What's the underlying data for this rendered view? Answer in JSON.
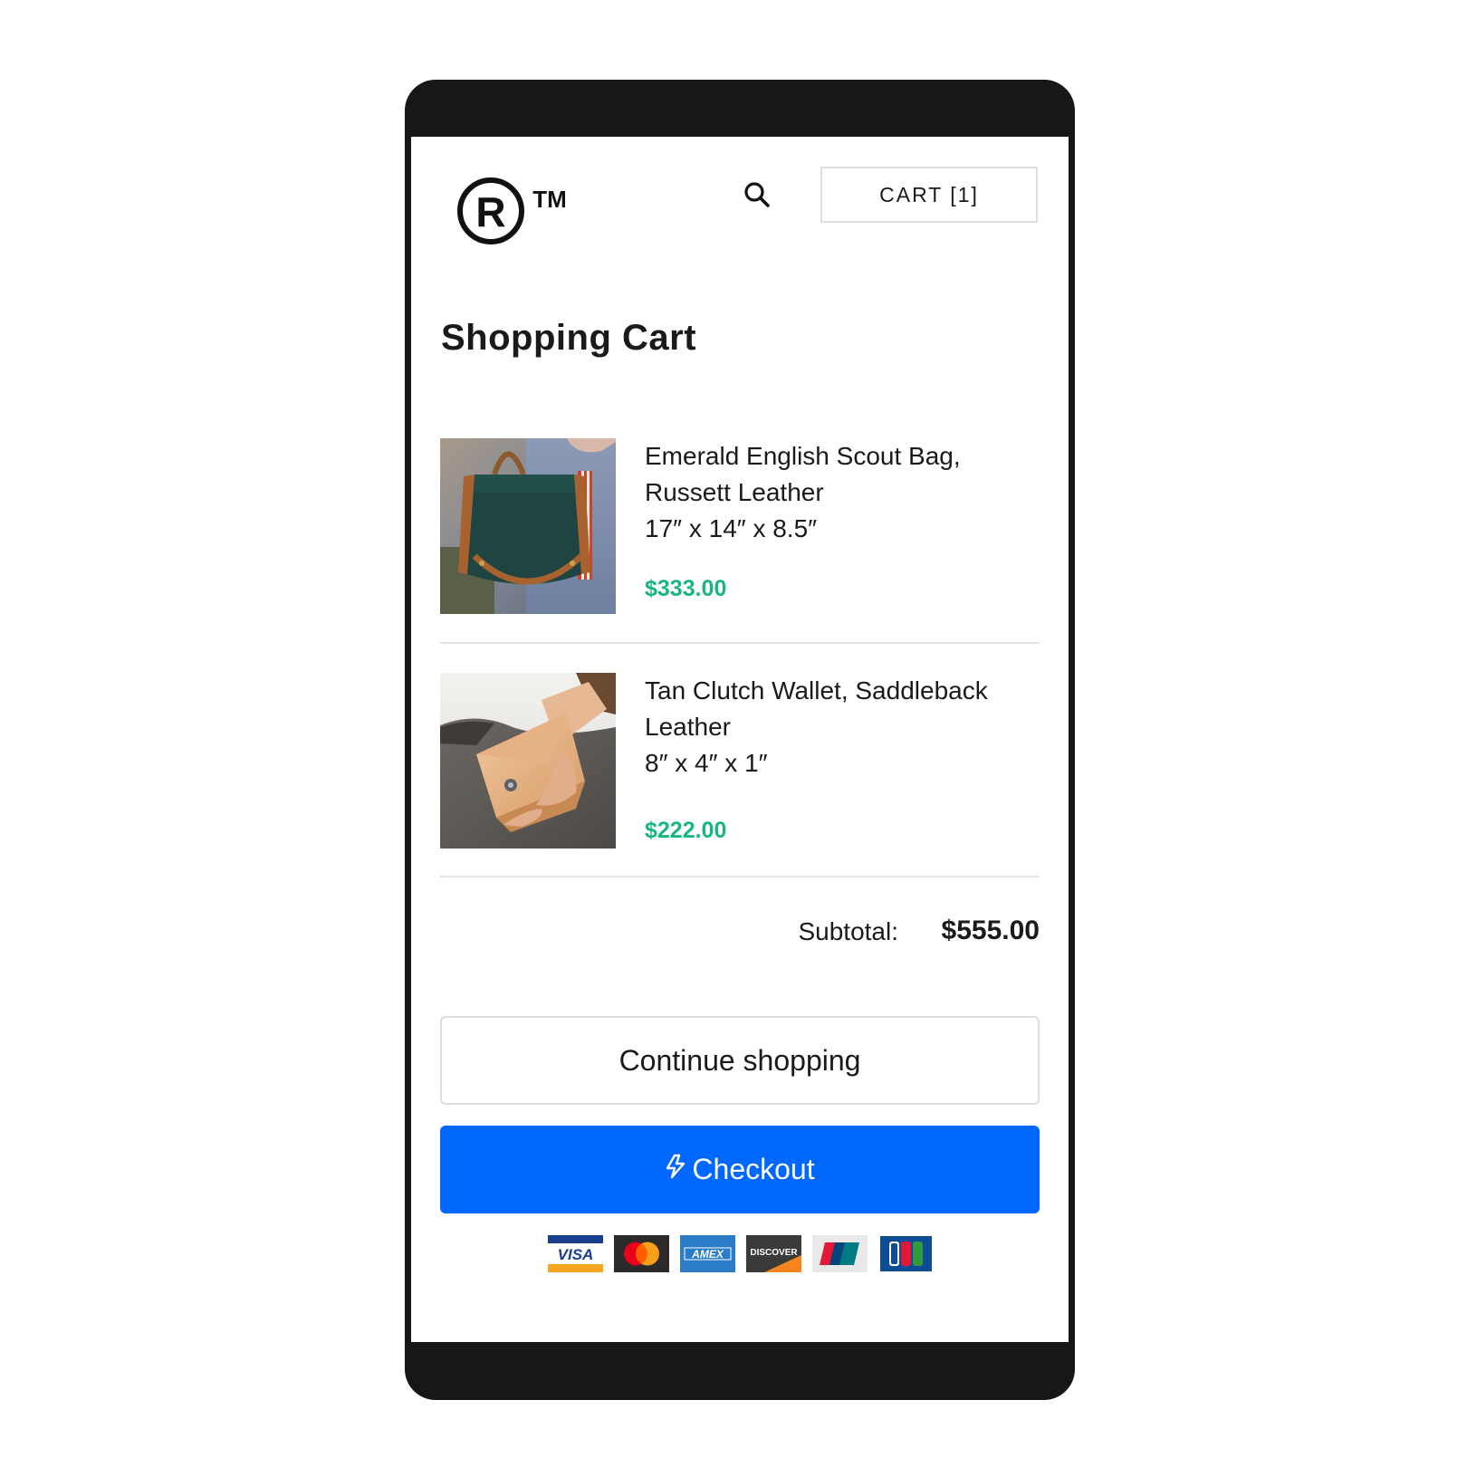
{
  "header": {
    "cart_label": "CART [1]"
  },
  "page_title": "Shopping Cart",
  "items": [
    {
      "name": "Emerald English Scout Bag, Russett Leather",
      "dimensions": "17″ x 14″ x 8.5″",
      "price": "$333.00"
    },
    {
      "name": "Tan Clutch Wallet, Saddleback Leather",
      "dimensions": "8″ x 4″ x 1″",
      "price": "$222.00"
    }
  ],
  "summary": {
    "subtotal_label": "Subtotal:",
    "subtotal_value": "$555.00"
  },
  "actions": {
    "continue_label": "Continue shopping",
    "checkout_label": "Checkout"
  },
  "payment_methods": {
    "visa": "VISA",
    "mastercard": "mastercard-logo",
    "amex": "AMEX",
    "discover": "DISCOVER",
    "unionpay": "unionpay-logo",
    "jcb": "jcb-logo"
  },
  "colors": {
    "price_green": "#19b77e",
    "checkout_blue": "#0068ff",
    "device_frame": "#171717"
  },
  "icons": {
    "search": "search-icon",
    "checkout": "lightning-bolt-icon"
  }
}
